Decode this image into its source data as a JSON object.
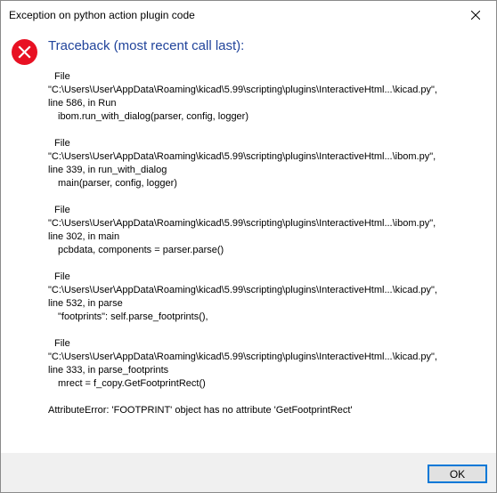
{
  "window": {
    "title": "Exception on python action plugin code",
    "close_icon": "close-icon"
  },
  "dialog": {
    "icon": "error-icon",
    "icon_color": "#e81123",
    "heading": "Traceback (most recent call last):",
    "heading_color": "#21449b",
    "frames": [
      {
        "file_label": "File",
        "path": "\"C:\\Users\\User\\AppData\\Roaming\\kicad\\5.99\\scripting\\plugins\\InteractiveHtml...\\kicad.py\",",
        "location": "line 586, in Run",
        "code": "ibom.run_with_dialog(parser, config, logger)"
      },
      {
        "file_label": "File",
        "path": "\"C:\\Users\\User\\AppData\\Roaming\\kicad\\5.99\\scripting\\plugins\\InteractiveHtml...\\ibom.py\",",
        "location": "line 339, in run_with_dialog",
        "code": "main(parser, config, logger)"
      },
      {
        "file_label": "File",
        "path": "\"C:\\Users\\User\\AppData\\Roaming\\kicad\\5.99\\scripting\\plugins\\InteractiveHtml...\\ibom.py\",",
        "location": "line 302, in main",
        "code": "pcbdata, components = parser.parse()"
      },
      {
        "file_label": "File",
        "path": "\"C:\\Users\\User\\AppData\\Roaming\\kicad\\5.99\\scripting\\plugins\\InteractiveHtml...\\kicad.py\",",
        "location": "line 532, in parse",
        "code": "\"footprints\": self.parse_footprints(),"
      },
      {
        "file_label": "File",
        "path": "\"C:\\Users\\User\\AppData\\Roaming\\kicad\\5.99\\scripting\\plugins\\InteractiveHtml...\\kicad.py\",",
        "location": "line 333, in parse_footprints",
        "code": "mrect = f_copy.GetFootprintRect()"
      }
    ],
    "error_message": "AttributeError: 'FOOTPRINT' object has no attribute 'GetFootprintRect'"
  },
  "footer": {
    "ok_label": "OK",
    "accent_color": "#0078d7"
  }
}
